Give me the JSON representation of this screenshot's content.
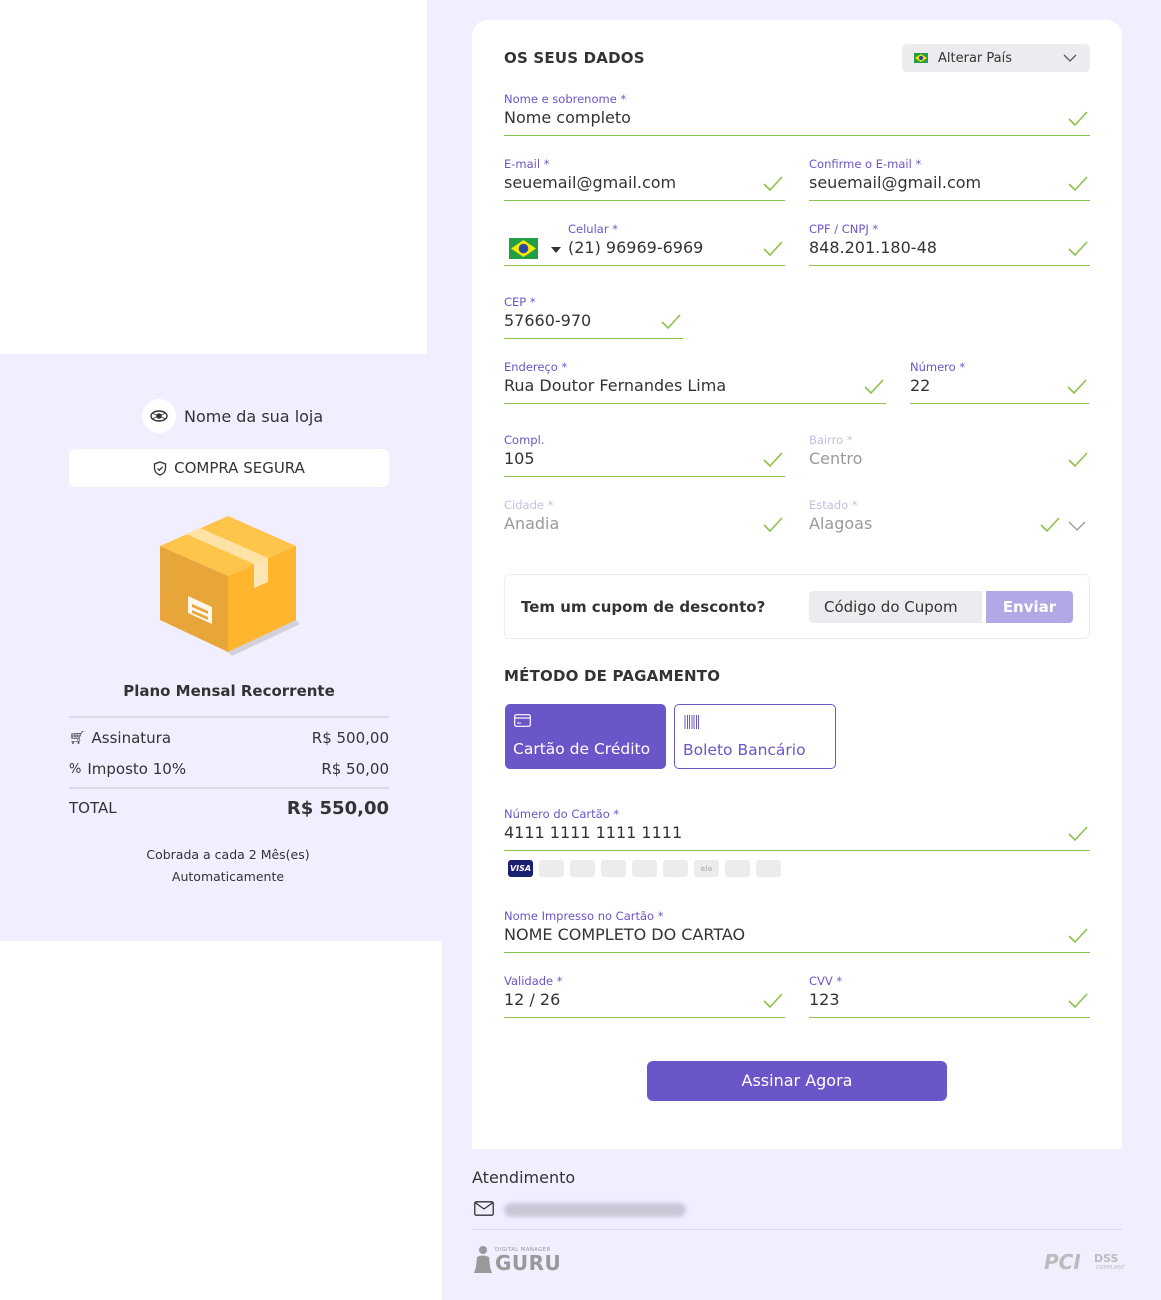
{
  "store": {
    "name": "Nome da sua loja",
    "secure_label": "COMPRA SEGURA"
  },
  "summary": {
    "plan_name": "Plano Mensal Recorrente",
    "lines": [
      {
        "icon": "cart-icon",
        "label": "Assinatura",
        "value": "R$ 500,00"
      },
      {
        "icon": "percent-icon",
        "label": "Imposto 10%",
        "value": "R$ 50,00"
      }
    ],
    "total_label": "TOTAL",
    "total_value": "R$ 550,00",
    "billing_line1": "Cobrada a cada 2 Mês(es)",
    "billing_line2": "Automaticamente"
  },
  "form": {
    "title": "OS SEUS DADOS",
    "country_button": "Alterar País",
    "fields": {
      "name": {
        "label": "Nome e sobrenome *",
        "value": "Nome completo"
      },
      "email": {
        "label": "E-mail *",
        "value": "seuemail@gmail.com"
      },
      "email_confirm": {
        "label": "Confirme o E-mail *",
        "value": "seuemail@gmail.com"
      },
      "phone": {
        "label": "Celular *",
        "value": "(21) 96969-6969"
      },
      "cpf": {
        "label": "CPF / CNPJ *",
        "value": "848.201.180-48"
      },
      "cep": {
        "label": "CEP *",
        "value": "57660-970"
      },
      "address": {
        "label": "Endereço *",
        "value": "Rua Doutor Fernandes Lima"
      },
      "number": {
        "label": "Número *",
        "value": "22"
      },
      "complement": {
        "label": "Compl.",
        "value": "105"
      },
      "district": {
        "label": "Bairro *",
        "value": "Centro"
      },
      "city": {
        "label": "Cidade *",
        "value": "Anadia"
      },
      "state": {
        "label": "Estado *",
        "value": "Alagoas"
      }
    }
  },
  "coupon": {
    "question": "Tem um cupom de desconto?",
    "placeholder": "Código do Cupom",
    "button": "Enviar"
  },
  "payment": {
    "title": "MÉTODO DE PAGAMENTO",
    "methods": [
      {
        "label": "Cartão de Crédito",
        "selected": true
      },
      {
        "label": "Boleto Bancário",
        "selected": false
      }
    ],
    "card_number": {
      "label": "Número do Cartão *",
      "value": "4111 1111 1111 1111"
    },
    "brands": [
      "VISA",
      "MC",
      "AMEX",
      "DINERS",
      "DISCOVER",
      "JCB",
      "elo",
      "HIPER",
      "AURA"
    ],
    "card_name": {
      "label": "Nome Impresso no Cartão *",
      "value": "NOME COMPLETO DO CARTAO"
    },
    "expiry": {
      "label": "Validade *",
      "value": "12 / 26"
    },
    "cvv": {
      "label": "CVV *",
      "value": "123"
    },
    "submit": "Assinar Agora"
  },
  "footer": {
    "support_title": "Atendimento",
    "guru_small": "DIGITAL MANAGER",
    "guru_big": "GURU",
    "pci": "PCI",
    "dss": "DSS",
    "compliant": "COMPLIANT"
  },
  "colors": {
    "accent": "#6a55c9",
    "background": "#f1efff",
    "success": "#8bc34a"
  }
}
